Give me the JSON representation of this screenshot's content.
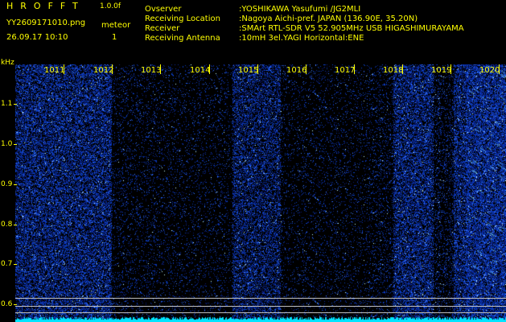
{
  "header": {
    "tagline": "HROFFT",
    "version": "1.0.0f",
    "filename": "YY2609171010.png",
    "timestamp": "26.09.17 10:10",
    "meteor_label": "meteor",
    "meteor_count": "1"
  },
  "info": {
    "observer_label": "Ovserver",
    "observer_value": ":YOSHIKAWA Yasufumi /JG2MLI",
    "location_label": "Receiving Location",
    "location_value": ":Nagoya Aichi-pref. JAPAN (136.90E, 35.20N)",
    "receiver_label": "Receiver",
    "receiver_value": ":SMArt RTL-SDR V5 52.905MHz USB HIGASHIMURAYAMA",
    "antenna_label": "Receiving Antenna",
    "antenna_value": ":10mH 3el.YAGI Horizontal:ENE"
  },
  "spectrogram": {
    "y_unit": "kHz",
    "y_ticks": [
      "1.1",
      "1.0",
      "0.9",
      "0.8",
      "0.7",
      "0.6"
    ],
    "x_ticks": [
      "1011",
      "1012",
      "1013",
      "1014",
      "1015",
      "1016",
      "1017",
      "1018",
      "1019",
      "1020"
    ],
    "colors": {
      "background": "#000000",
      "noise": "#1a3cff",
      "signal": "#00ffff",
      "labels": "#ffff00"
    }
  }
}
